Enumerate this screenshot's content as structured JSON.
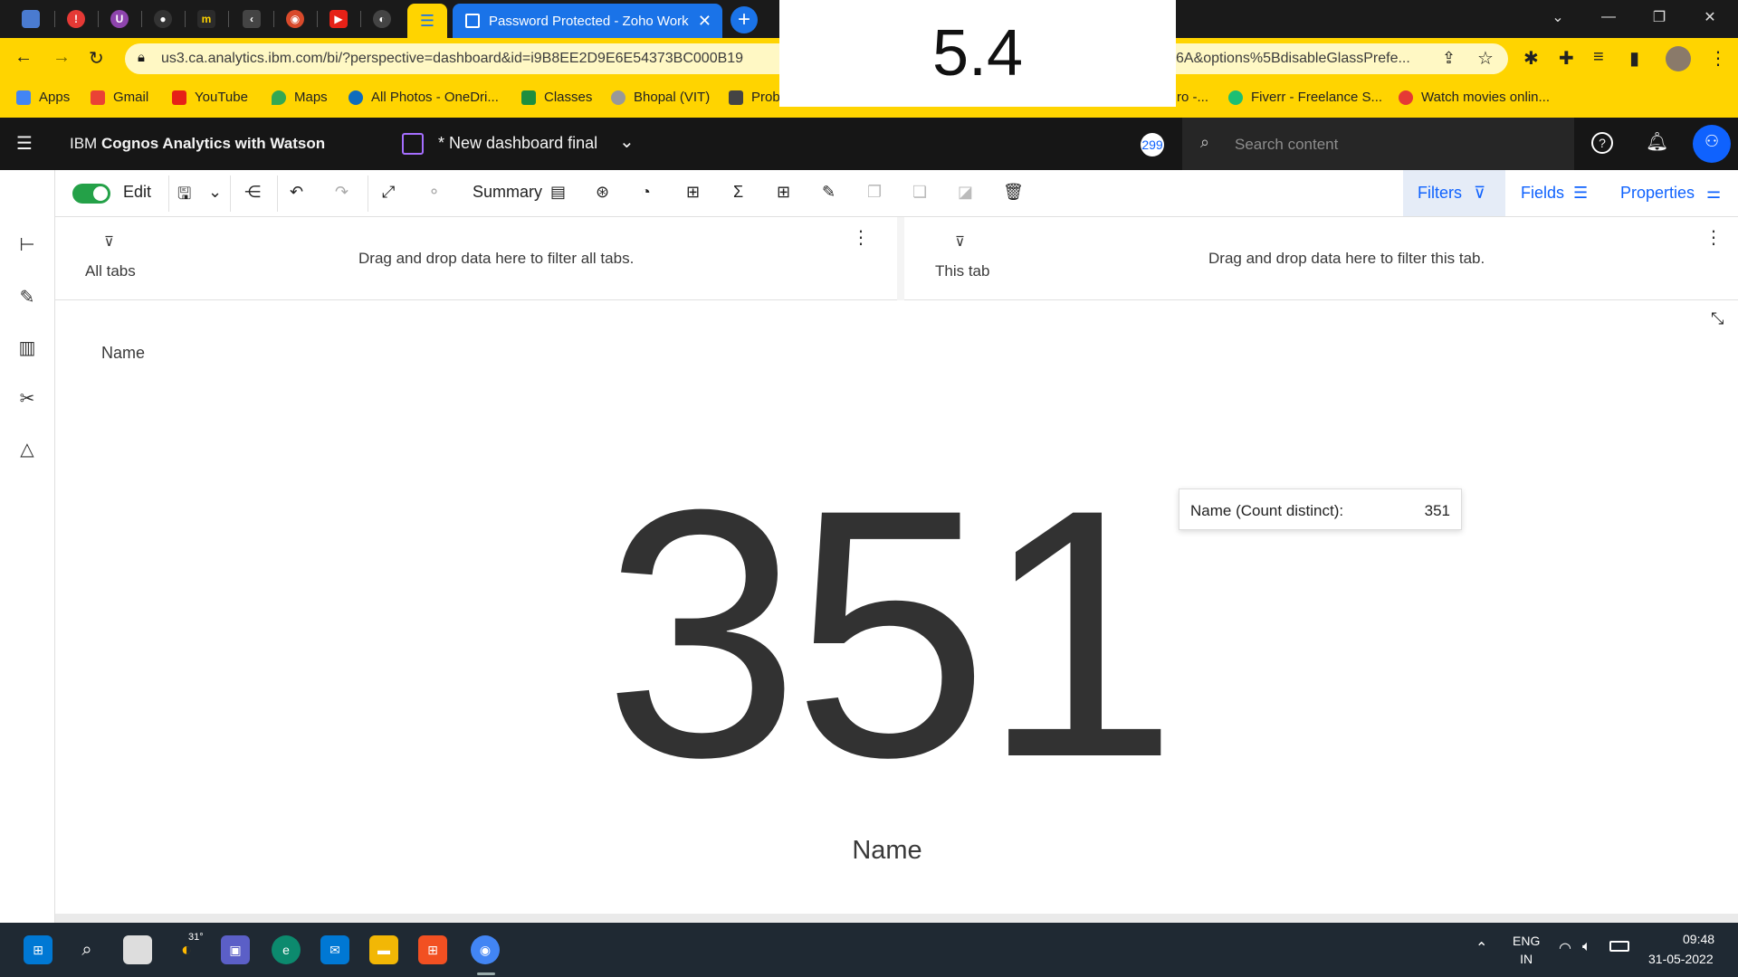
{
  "browser": {
    "active_tab_title": "Password Protected - Zoho Work",
    "url_left": "us3.ca.analytics.ibm.com/bi/?perspective=dashboard&id=i9B8EE2D9E6E54373BC000B19",
    "url_right": "6A&options%5BdisableGlassPrefe...",
    "bookmarks": {
      "apps": "Apps",
      "gmail": "Gmail",
      "youtube": "YouTube",
      "maps": "Maps",
      "onedrive": "All Photos - OneDri...",
      "classes": "Classes",
      "bhopal": "Bhopal (VIT)",
      "prob": "Prob",
      "ro": "ro -...",
      "fiverr": "Fiverr - Freelance S...",
      "movies": "Watch movies onlin..."
    }
  },
  "overlay": {
    "value": "5.4"
  },
  "app": {
    "brand_prefix": "IBM ",
    "brand_bold": "Cognos Analytics with Watson",
    "dashboard_title": "* New dashboard final",
    "notification_count": "299",
    "search_placeholder": "Search content"
  },
  "toolbar": {
    "edit_label": "Edit",
    "summary_label": "Summary",
    "filters_label": "Filters",
    "fields_label": "Fields",
    "properties_label": "Properties"
  },
  "filters": {
    "all_tabs_label": "All tabs",
    "all_tabs_hint": "Drag and drop data here to filter all tabs.",
    "this_tab_label": "This tab",
    "this_tab_hint": "Drag and drop data here to filter this tab."
  },
  "widget": {
    "title": "Name",
    "kpi_value": "351",
    "kpi_label": "Name",
    "tooltip_key": "Name (Count distinct):",
    "tooltip_value": "351"
  },
  "taskbar": {
    "weather": "31°",
    "lang_line1": "ENG",
    "lang_line2": "IN",
    "time": "09:48",
    "date": "31-05-2022"
  }
}
